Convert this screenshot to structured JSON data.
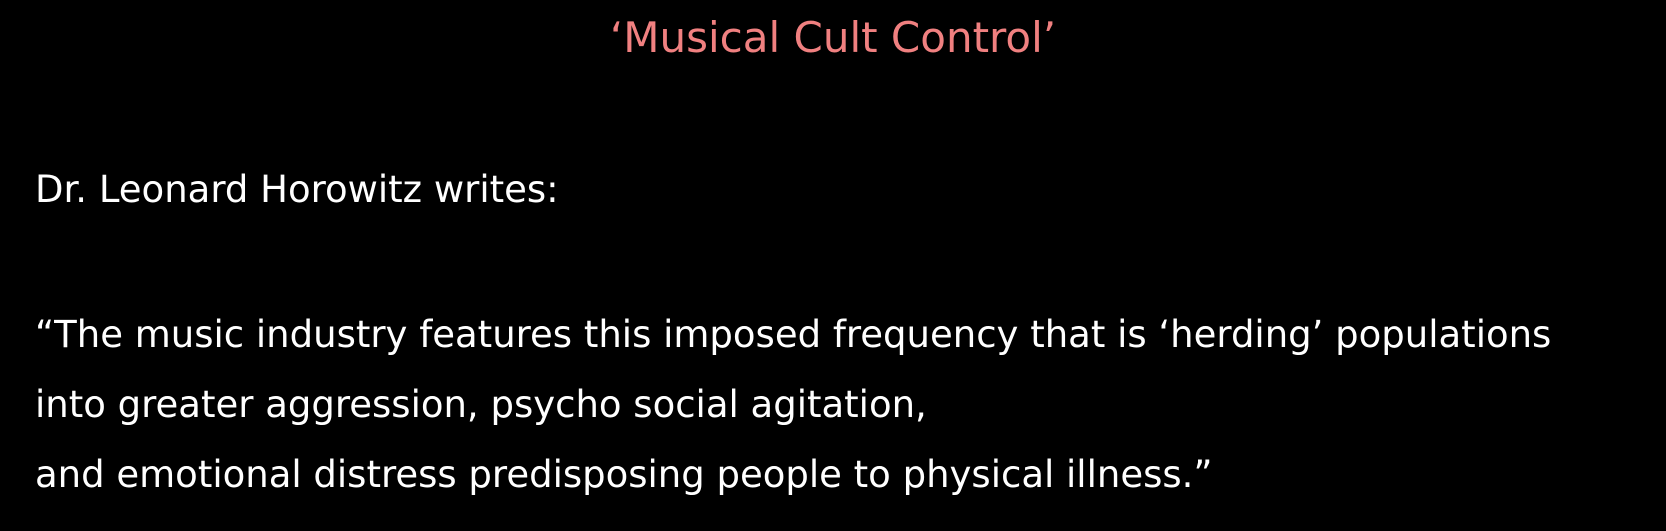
{
  "slide": {
    "title": "‘Musical Cult Control’",
    "author_line": "Dr. Leonard Horowitz writes:",
    "quote_lines": [
      "“The music industry features this imposed frequency that is ‘herding’ populations",
      "into greater aggression, psycho social agitation,",
      "and emotional distress predisposing people to physical illness.”"
    ],
    "colors": {
      "background": "#000000",
      "title": "#f08080",
      "body_text": "#ffffff"
    }
  }
}
